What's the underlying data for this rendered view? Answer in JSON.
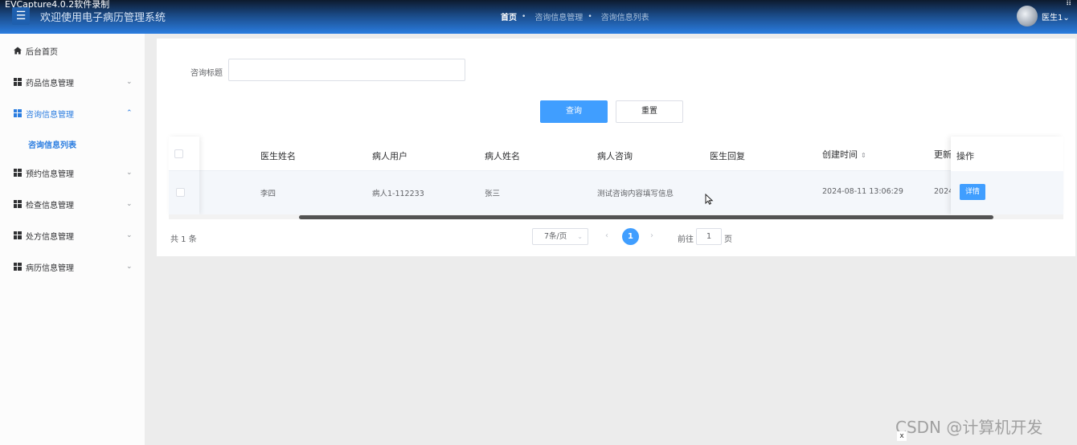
{
  "capture_label": "EVCapture4.0.2软件录制",
  "header": {
    "menu_icon": "☰",
    "title": "欢迎使用电子病历管理系统",
    "breadcrumb": [
      "首页",
      "咨询信息管理",
      "咨询信息列表"
    ],
    "user_name": "医生1",
    "user_caret": "⌄",
    "corner_icon": "⠿"
  },
  "sidebar": {
    "items": [
      {
        "label": "后台首页",
        "icon": "home-icon"
      },
      {
        "label": "药品信息管理",
        "icon": "grid-icon",
        "arrow": "⌄"
      },
      {
        "label": "咨询信息管理",
        "icon": "grid-icon",
        "arrow": "⌃"
      },
      {
        "label": "预约信息管理",
        "icon": "grid-icon",
        "arrow": "⌄"
      },
      {
        "label": "检查信息管理",
        "icon": "grid-icon",
        "arrow": "⌄"
      },
      {
        "label": "处方信息管理",
        "icon": "grid-icon",
        "arrow": "⌄"
      },
      {
        "label": "病历信息管理",
        "icon": "grid-icon",
        "arrow": "⌄"
      }
    ],
    "sub_item": "咨询信息列表"
  },
  "search": {
    "label": "咨询标题",
    "value": "",
    "query_button": "查询",
    "reset_button": "重置"
  },
  "table": {
    "headers": [
      "医生姓名",
      "病人用户",
      "病人姓名",
      "病人咨询",
      "医生回复",
      "创建时间",
      "更新",
      "操作"
    ],
    "rows": [
      {
        "doctor": "李四",
        "patient_user": "病人1-112233",
        "patient_name": "张三",
        "consult": "测试咨询内容填写信息",
        "reply": "",
        "created": "2024-08-11 13:06:29",
        "updated": "2024",
        "action": "详情"
      }
    ]
  },
  "pagination": {
    "total": "共 1 条",
    "page_size": "7条/页",
    "page_size_caret": "⌄",
    "prev": "‹",
    "current_page": "1",
    "next": "›",
    "goto_label": "前往",
    "goto_value": "1",
    "goto_suffix": "页"
  },
  "watermark": "CSDN @计算机开发",
  "close_icon": "x",
  "colors": {
    "accent": "#409eff",
    "header": "#2b7de0",
    "active_nav": "#2b7de0"
  }
}
